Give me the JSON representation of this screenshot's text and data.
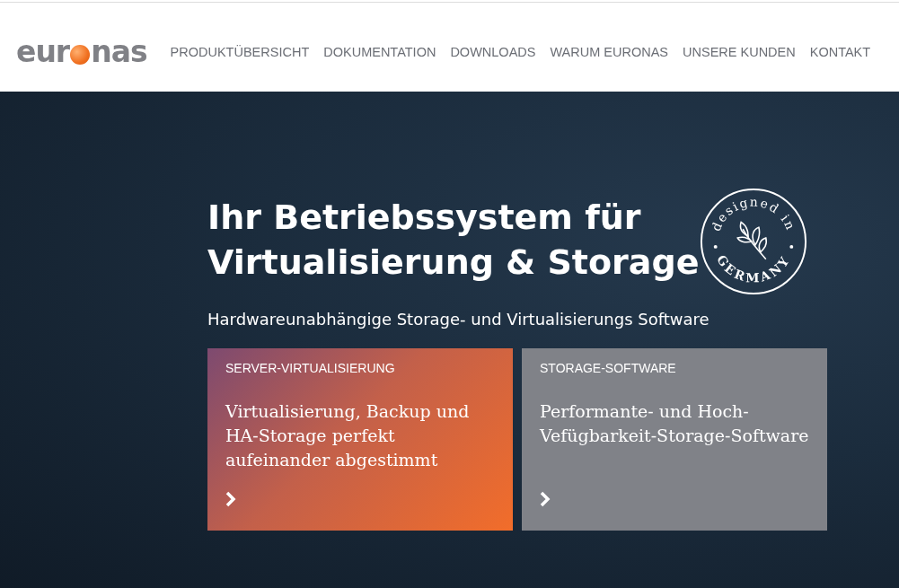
{
  "logo": {
    "before": "eur",
    "after": "nas"
  },
  "nav": [
    {
      "label": "PRODUKTÜBERSICHT"
    },
    {
      "label": "DOKUMENTATION"
    },
    {
      "label": "DOWNLOADS"
    },
    {
      "label": "WARUM EURONAS"
    },
    {
      "label": "UNSERE KUNDEN"
    },
    {
      "label": "KONTAKT"
    }
  ],
  "hero": {
    "title_lines": [
      "Ihr Betriebssystem für",
      "Virtualisierung & Storage"
    ],
    "subtitle": "Hardwareunabhängige Storage- und Virtualisierungs Software",
    "badge": {
      "top_text": "designed in",
      "bottom_text": "GERMANY"
    }
  },
  "cards": [
    {
      "kind": "gradient",
      "heading": "SERVER-VIRTUALISIERUNG",
      "text": "Virtualisierung, Backup und HA-Storage perfekt aufeinander abgestimmt"
    },
    {
      "kind": "plain",
      "heading": "STORAGE-SOFTWARE",
      "text": "Performante- und Hoch-Vefügbarkeit-Storage-Software"
    }
  ]
}
